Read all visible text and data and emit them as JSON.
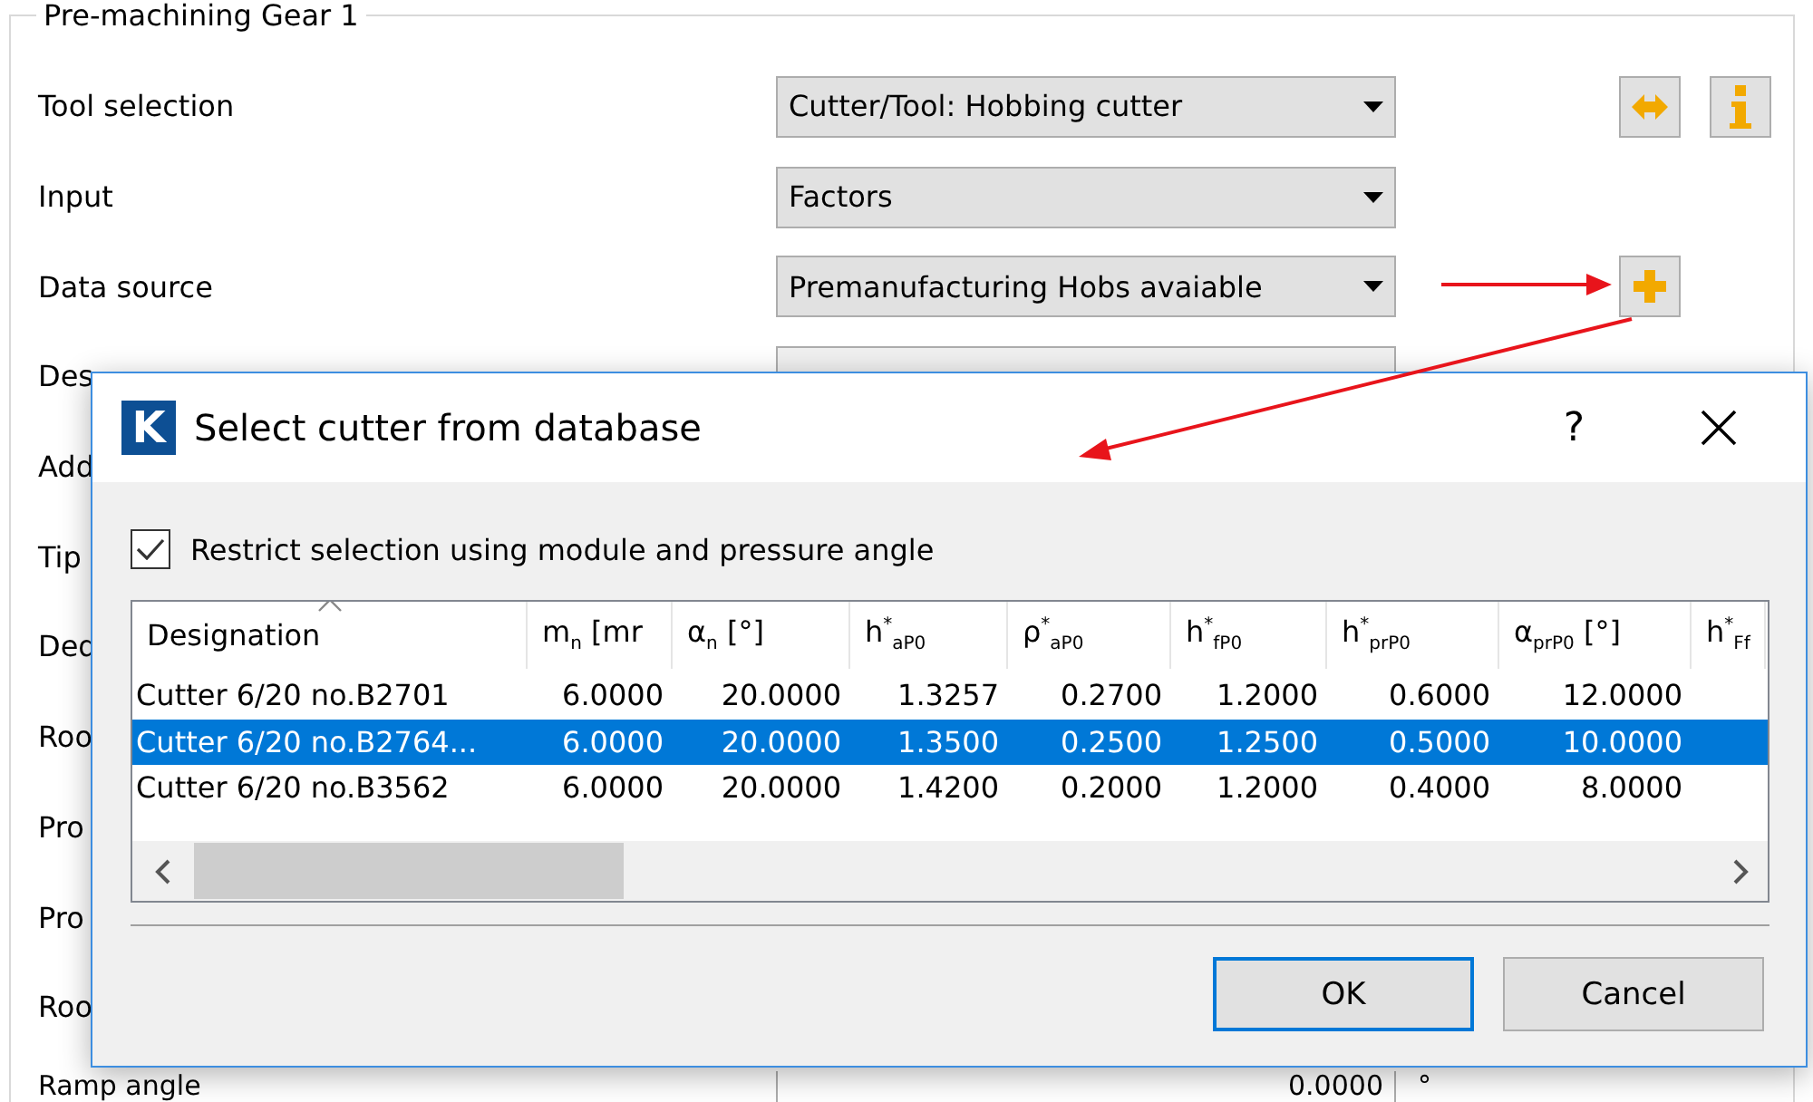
{
  "panel": {
    "legend": "Pre-machining Gear 1",
    "rows": [
      {
        "label": "Tool selection",
        "kind": "dropdown",
        "value": "Cutter/Tool: Hobbing cutter",
        "actions": [
          {
            "kind": "swap"
          },
          {
            "kind": "info"
          }
        ]
      },
      {
        "label": "Input",
        "kind": "dropdown",
        "value": "Factors"
      },
      {
        "label": "Data source",
        "kind": "dropdown",
        "value": "Premanufacturing Hobs avaiable",
        "actions": [
          {
            "kind": "add"
          }
        ]
      },
      {
        "label": "Des",
        "kind": "field"
      },
      {
        "label": "Add",
        "kind": "label"
      },
      {
        "label": "Tip",
        "kind": "label"
      },
      {
        "label": "Ded",
        "kind": "label"
      },
      {
        "label": "Roo",
        "kind": "label"
      },
      {
        "label": "Pro",
        "kind": "label"
      },
      {
        "label": "Pro",
        "kind": "label"
      },
      {
        "label": "Roo",
        "kind": "label"
      },
      {
        "label": "Ramp angle",
        "kind": "number",
        "value": "0.0000",
        "unit": "°"
      }
    ]
  },
  "dialog": {
    "logo": "K",
    "title": "Select cutter from database",
    "help": "?",
    "checkbox": {
      "label": "Restrict selection using module and pressure angle",
      "checked": true
    },
    "table": {
      "columns": [
        {
          "label": "Designation",
          "sorted": true
        },
        {
          "label": "m$_{n}$ [mr",
          "sorted": false
        },
        {
          "label": "α$_{n}$ [°]",
          "sorted": false
        },
        {
          "label": "h$^{*}$$_{aP0}$",
          "sorted": false
        },
        {
          "label": "ρ$^{*}$$_{aP0}$",
          "sorted": false
        },
        {
          "label": "h$^{*}$$_{fP0}$",
          "sorted": false
        },
        {
          "label": "h$^{*}$$_{prP0}$",
          "sorted": false
        },
        {
          "label": "α$_{prP0}$ [°]",
          "sorted": false
        },
        {
          "label": "h$^{*}$$_{Ff}$",
          "sorted": false
        }
      ],
      "rows": [
        {
          "selected": false,
          "cells": [
            "Cutter 6/20 no.B2701",
            "6.0000",
            "20.0000",
            "1.3257",
            "0.2700",
            "1.2000",
            "0.6000",
            "12.0000"
          ]
        },
        {
          "selected": true,
          "cells": [
            "Cutter 6/20 no.B2764...",
            "6.0000",
            "20.0000",
            "1.3500",
            "0.2500",
            "1.2500",
            "0.5000",
            "10.0000"
          ]
        },
        {
          "selected": false,
          "cells": [
            "Cutter 6/20 no.B3562",
            "6.0000",
            "20.0000",
            "1.4200",
            "0.2000",
            "1.2000",
            "0.4000",
            "8.0000"
          ]
        }
      ]
    },
    "buttons": [
      {
        "label": "OK",
        "default": true
      },
      {
        "label": "Cancel",
        "default": false
      }
    ]
  }
}
